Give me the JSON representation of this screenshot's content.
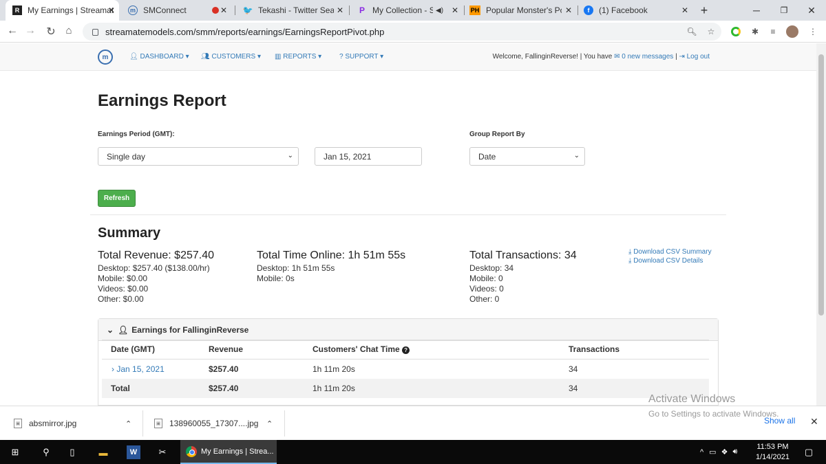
{
  "browser": {
    "tabs": [
      {
        "title": "My Earnings | Streamate",
        "icon": "streamate-favicon",
        "active": true
      },
      {
        "title": "SMConnect",
        "icon": "smconnect-favicon",
        "active": false
      },
      {
        "title": "",
        "icon": "record-icon",
        "active": false
      },
      {
        "title": "Tekashi - Twitter Search",
        "icon": "twitter-icon",
        "active": false
      },
      {
        "title": "My Collection - Sta",
        "icon": "picsart-icon",
        "active": false
      },
      {
        "title": "Popular Monster's Porn",
        "icon": "ph-icon",
        "active": false
      },
      {
        "title": "(1) Facebook",
        "icon": "facebook-icon",
        "active": false
      }
    ],
    "url": "streamatemodels.com/smm/reports/earnings/EarningsReportPivot.php"
  },
  "nav": {
    "dashboard": "DASHBOARD",
    "customers": "CUSTOMERS",
    "reports": "REPORTS",
    "support": "SUPPORT",
    "welcome": "Welcome, FallinginReverse! | You have",
    "messages": "0 new messages",
    "sep": "|",
    "logout": "Log out"
  },
  "page": {
    "title": "Earnings Report",
    "period_label": "Earnings Period (GMT):",
    "period_value": "Single day",
    "date_value": "Jan 15, 2021",
    "group_label": "Group Report By",
    "group_value": "Date",
    "refresh": "Refresh"
  },
  "summary": {
    "title": "Summary",
    "revenue": {
      "headline": "Total Revenue: $257.40",
      "lines": [
        "Desktop: $257.40 ($138.00/hr)",
        "Mobile: $0.00",
        "Videos: $0.00",
        "Other: $0.00"
      ]
    },
    "time": {
      "headline": "Total Time Online: 1h 51m 55s",
      "lines": [
        "Desktop: 1h 51m 55s",
        "Mobile: 0s"
      ]
    },
    "transactions": {
      "headline": "Total Transactions: 34",
      "lines": [
        "Desktop: 34",
        "Mobile: 0",
        "Videos: 0",
        "Other: 0"
      ]
    },
    "download_summary": "Download CSV Summary",
    "download_details": "Download CSV Details"
  },
  "earnings_panel": {
    "heading": "Earnings for FallinginReverse",
    "columns": [
      "Date (GMT)",
      "Revenue",
      "Customers' Chat Time",
      "Transactions"
    ],
    "rows": [
      {
        "date": "Jan 15, 2021",
        "revenue": "$257.40",
        "chat_time": "1h 11m 20s",
        "transactions": "34"
      }
    ],
    "total": {
      "label": "Total",
      "revenue": "$257.40",
      "chat_time": "1h 11m 20s",
      "transactions": "34"
    }
  },
  "watermark": {
    "line1": "Activate Windows",
    "line2": "Go to Settings to activate Windows."
  },
  "downloads": {
    "items": [
      "absmirror.jpg",
      "138960055_17307....jpg"
    ],
    "show_all": "Show all"
  },
  "taskbar": {
    "chrome_label": "My Earnings | Strea...",
    "time": "11:53 PM",
    "date": "1/14/2021"
  }
}
